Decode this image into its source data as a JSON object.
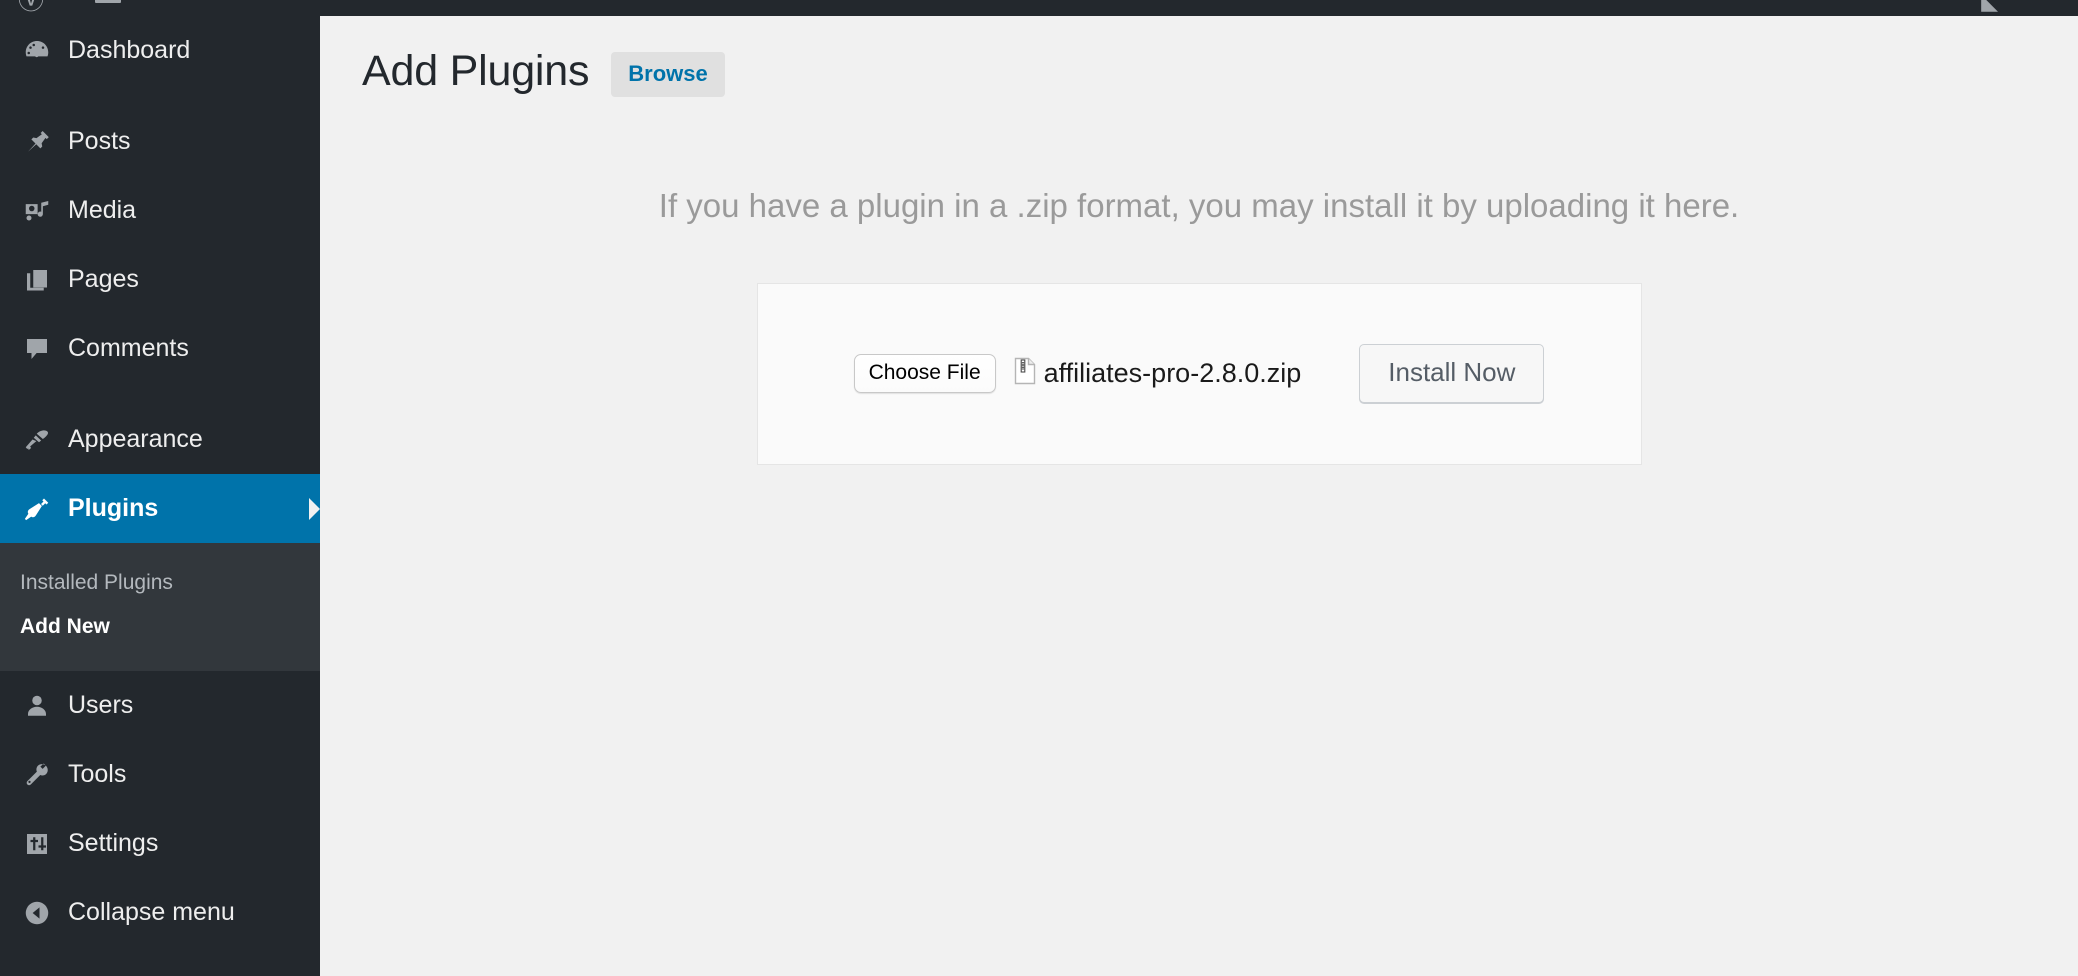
{
  "admin_bar": {
    "items": [
      {
        "name": "wordpress-logo-icon",
        "glyph": "Ⓦ"
      },
      {
        "name": "site-name-icon",
        "glyph": ""
      },
      {
        "name": "comments-icon",
        "glyph": ""
      }
    ]
  },
  "sidebar": {
    "items": [
      {
        "label": "Dashboard",
        "icon": "dashboard-icon",
        "current": false,
        "spacer_after": true
      },
      {
        "label": "Posts",
        "icon": "posts-pin-icon",
        "current": false,
        "spacer_after": false
      },
      {
        "label": "Media",
        "icon": "media-icon",
        "current": false,
        "spacer_after": false
      },
      {
        "label": "Pages",
        "icon": "pages-icon",
        "current": false,
        "spacer_after": false
      },
      {
        "label": "Comments",
        "icon": "comments-bubble-icon",
        "current": false,
        "spacer_after": true
      },
      {
        "label": "Appearance",
        "icon": "appearance-brush-icon",
        "current": false,
        "spacer_after": false
      },
      {
        "label": "Plugins",
        "icon": "plugins-plug-icon",
        "current": true,
        "spacer_after": false
      },
      {
        "label": "Users",
        "icon": "users-icon",
        "current": false,
        "spacer_after": false
      },
      {
        "label": "Tools",
        "icon": "tools-wrench-icon",
        "current": false,
        "spacer_after": false
      },
      {
        "label": "Settings",
        "icon": "settings-sliders-icon",
        "current": false,
        "spacer_after": false
      },
      {
        "label": "Collapse menu",
        "icon": "collapse-arrow-icon",
        "current": false,
        "spacer_after": false
      }
    ],
    "plugins_submenu": [
      {
        "label": "Installed Plugins",
        "current": false
      },
      {
        "label": "Add New",
        "current": true
      }
    ],
    "colors": {
      "background": "#23282d",
      "submenu_background": "#32373c",
      "current_highlight": "#0073aa",
      "text": "#eeeeee",
      "muted_text": "#b4b9be"
    }
  },
  "header": {
    "title": "Add Plugins",
    "browse_tab_label": "Browse",
    "browse_tab_color": "#0073aa"
  },
  "upload": {
    "instructions": "If you have a plugin in a .zip format, you may install it by uploading it here.",
    "choose_file_label": "Choose File",
    "file_name": "affiliates-pro-2.8.0.zip",
    "file_icon": "zip-file-icon",
    "install_button_label": "Install Now"
  }
}
